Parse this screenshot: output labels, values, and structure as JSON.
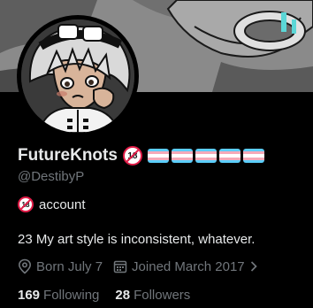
{
  "profile": {
    "display_name": "FutureKnots",
    "handle": "@DestibyP",
    "name_badge": "18",
    "flag_count": 5,
    "account_badge": "18",
    "account_text": "account",
    "bio": "23 My art style is inconsistent, whatever.",
    "location": "Born July 7",
    "joined": "Joined March 2017",
    "following_count": "169",
    "following_label": "Following",
    "followers_count": "28",
    "followers_label": "Followers"
  },
  "icons": {
    "location": "map-pin-icon",
    "calendar": "calendar-icon",
    "chevron": "chevron-right-icon",
    "adult_badge": "no-under-18-icon",
    "flag": "transgender-flag-icon"
  },
  "colors": {
    "background": "#000000",
    "text_primary": "#e7e9ea",
    "text_secondary": "#71767b",
    "trans_blue": "#5bcefa",
    "trans_pink": "#f5a9b8",
    "trans_white": "#ffffff",
    "badge_red": "#e11d48"
  }
}
